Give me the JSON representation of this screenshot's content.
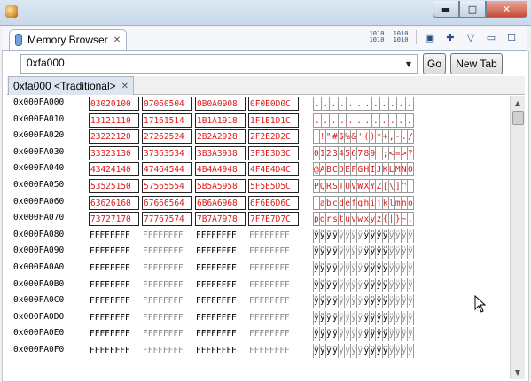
{
  "window": {
    "close_glyph": "✕",
    "minimize_glyph": "▬",
    "maximize_glyph": "□"
  },
  "view": {
    "tab_label": "Memory Browser",
    "tab_close": "✕"
  },
  "toolbar": {
    "binary_1": "1010\n1010",
    "binary_2": "1010\n1010",
    "new_icon": "▣",
    "pin_icon": "✚",
    "menu_icon": "▽",
    "min_icon": "▭",
    "max_icon": "☐"
  },
  "address": {
    "value": "0xfa000",
    "arrow": "▼"
  },
  "buttons": {
    "go": "Go",
    "new_tab": "New Tab"
  },
  "rendering_tab": {
    "label": "0xfa000 <Traditional>",
    "close": "✕"
  },
  "memory": {
    "rows": [
      {
        "addr": "0x000FA000",
        "cells": [
          "03020100",
          "07060504",
          "0B0A0908",
          "0F0E0D0C"
        ],
        "ascii": [
          ".",
          ".",
          ".",
          ".",
          ".",
          ".",
          ".",
          "."
        ],
        "ascii2": [
          ".",
          ".",
          ".",
          "."
        ],
        "changed": true
      },
      {
        "addr": "0x000FA010",
        "cells": [
          "13121110",
          "17161514",
          "1B1A1918",
          "1F1E1D1C"
        ],
        "ascii": [
          ".",
          ".",
          ".",
          ".",
          ".",
          ".",
          ".",
          "."
        ],
        "ascii2": [
          ".",
          ".",
          ".",
          "."
        ],
        "changed": true
      },
      {
        "addr": "0x000FA020",
        "cells": [
          "23222120",
          "27262524",
          "2B2A2928",
          "2F2E2D2C"
        ],
        "ascii": [
          " ",
          "!",
          "\"",
          "#",
          "$",
          "%",
          "&",
          "'"
        ],
        "ascii2": [
          "(",
          ")",
          "*",
          "+",
          ",",
          "-",
          ".",
          "/"
        ],
        "changed": true
      },
      {
        "addr": "0x000FA030",
        "cells": [
          "33323130",
          "37363534",
          "3B3A3938",
          "3F3E3D3C"
        ],
        "ascii": [
          "0",
          "1",
          "2",
          "3",
          "4",
          "5",
          "6",
          "7"
        ],
        "ascii2": [
          "8",
          "9",
          ":",
          ";",
          "<",
          "=",
          ">",
          "?"
        ],
        "changed": true
      },
      {
        "addr": "0x000FA040",
        "cells": [
          "43424140",
          "47464544",
          "4B4A4948",
          "4F4E4D4C"
        ],
        "ascii": [
          "@",
          "A",
          "B",
          "C",
          "D",
          "E",
          "F",
          "G"
        ],
        "ascii2": [
          "H",
          "I",
          "J",
          "K",
          "L",
          "M",
          "N",
          "O"
        ],
        "changed": true
      },
      {
        "addr": "0x000FA050",
        "cells": [
          "53525150",
          "57565554",
          "5B5A5958",
          "5F5E5D5C"
        ],
        "ascii": [
          "P",
          "Q",
          "R",
          "S",
          "T",
          "U",
          "V",
          "W"
        ],
        "ascii2": [
          "X",
          "Y",
          "Z",
          "[",
          "\\",
          "]",
          "^",
          "_"
        ],
        "changed": true
      },
      {
        "addr": "0x000FA060",
        "cells": [
          "63626160",
          "67666564",
          "6B6A6968",
          "6F6E6D6C"
        ],
        "ascii": [
          "`",
          "a",
          "b",
          "c",
          "d",
          "e",
          "f",
          "g"
        ],
        "ascii2": [
          "h",
          "i",
          "j",
          "k",
          "l",
          "m",
          "n",
          "o"
        ],
        "changed": true
      },
      {
        "addr": "0x000FA070",
        "cells": [
          "73727170",
          "77767574",
          "7B7A7978",
          "7F7E7D7C"
        ],
        "ascii": [
          "p",
          "q",
          "r",
          "s",
          "t",
          "u",
          "v",
          "w"
        ],
        "ascii2": [
          "x",
          "y",
          "z",
          "{",
          "|",
          "}",
          "~",
          "."
        ],
        "changed": true
      },
      {
        "addr": "0x000FA080",
        "cells": [
          "FFFFFFFF",
          "FFFFFFFF",
          "FFFFFFFF",
          "FFFFFFFF"
        ],
        "ascii": [
          "ÿ",
          "ÿ",
          "ÿ",
          "ÿ",
          "ÿ",
          "ÿ",
          "ÿ",
          "ÿ"
        ],
        "ascii2": [
          "ÿ",
          "ÿ",
          "ÿ",
          "ÿ",
          "ÿ",
          "ÿ",
          "ÿ",
          "ÿ"
        ],
        "changed": false
      },
      {
        "addr": "0x000FA090",
        "cells": [
          "FFFFFFFF",
          "FFFFFFFF",
          "FFFFFFFF",
          "FFFFFFFF"
        ],
        "ascii": [
          "ÿ",
          "ÿ",
          "ÿ",
          "ÿ",
          "ÿ",
          "ÿ",
          "ÿ",
          "ÿ"
        ],
        "ascii2": [
          "ÿ",
          "ÿ",
          "ÿ",
          "ÿ",
          "ÿ",
          "ÿ",
          "ÿ",
          "ÿ"
        ],
        "changed": false
      },
      {
        "addr": "0x000FA0A0",
        "cells": [
          "FFFFFFFF",
          "FFFFFFFF",
          "FFFFFFFF",
          "FFFFFFFF"
        ],
        "ascii": [
          "ÿ",
          "ÿ",
          "ÿ",
          "ÿ",
          "ÿ",
          "ÿ",
          "ÿ",
          "ÿ"
        ],
        "ascii2": [
          "ÿ",
          "ÿ",
          "ÿ",
          "ÿ",
          "ÿ",
          "ÿ",
          "ÿ",
          "ÿ"
        ],
        "changed": false
      },
      {
        "addr": "0x000FA0B0",
        "cells": [
          "FFFFFFFF",
          "FFFFFFFF",
          "FFFFFFFF",
          "FFFFFFFF"
        ],
        "ascii": [
          "ÿ",
          "ÿ",
          "ÿ",
          "ÿ",
          "ÿ",
          "ÿ",
          "ÿ",
          "ÿ"
        ],
        "ascii2": [
          "ÿ",
          "ÿ",
          "ÿ",
          "ÿ",
          "ÿ",
          "ÿ",
          "ÿ",
          "ÿ"
        ],
        "changed": false
      },
      {
        "addr": "0x000FA0C0",
        "cells": [
          "FFFFFFFF",
          "FFFFFFFF",
          "FFFFFFFF",
          "FFFFFFFF"
        ],
        "ascii": [
          "ÿ",
          "ÿ",
          "ÿ",
          "ÿ",
          "ÿ",
          "ÿ",
          "ÿ",
          "ÿ"
        ],
        "ascii2": [
          "ÿ",
          "ÿ",
          "ÿ",
          "ÿ",
          "ÿ",
          "ÿ",
          "ÿ",
          "ÿ"
        ],
        "changed": false
      },
      {
        "addr": "0x000FA0D0",
        "cells": [
          "FFFFFFFF",
          "FFFFFFFF",
          "FFFFFFFF",
          "FFFFFFFF"
        ],
        "ascii": [
          "ÿ",
          "ÿ",
          "ÿ",
          "ÿ",
          "ÿ",
          "ÿ",
          "ÿ",
          "ÿ"
        ],
        "ascii2": [
          "ÿ",
          "ÿ",
          "ÿ",
          "ÿ",
          "ÿ",
          "ÿ",
          "ÿ",
          "ÿ"
        ],
        "changed": false
      },
      {
        "addr": "0x000FA0E0",
        "cells": [
          "FFFFFFFF",
          "FFFFFFFF",
          "FFFFFFFF",
          "FFFFFFFF"
        ],
        "ascii": [
          "ÿ",
          "ÿ",
          "ÿ",
          "ÿ",
          "ÿ",
          "ÿ",
          "ÿ",
          "ÿ"
        ],
        "ascii2": [
          "ÿ",
          "ÿ",
          "ÿ",
          "ÿ",
          "ÿ",
          "ÿ",
          "ÿ",
          "ÿ"
        ],
        "changed": false
      },
      {
        "addr": "0x000FA0F0",
        "cells": [
          "FFFFFFFF",
          "FFFFFFFF",
          "FFFFFFFF",
          "FFFFFFFF"
        ],
        "ascii": [
          "ÿ",
          "ÿ",
          "ÿ",
          "ÿ",
          "ÿ",
          "ÿ",
          "ÿ",
          "ÿ"
        ],
        "ascii2": [
          "ÿ",
          "ÿ",
          "ÿ",
          "ÿ",
          "ÿ",
          "ÿ",
          "ÿ",
          "ÿ"
        ],
        "changed": false
      }
    ]
  },
  "scrollbar": {
    "up": "▲",
    "down": "▼"
  }
}
